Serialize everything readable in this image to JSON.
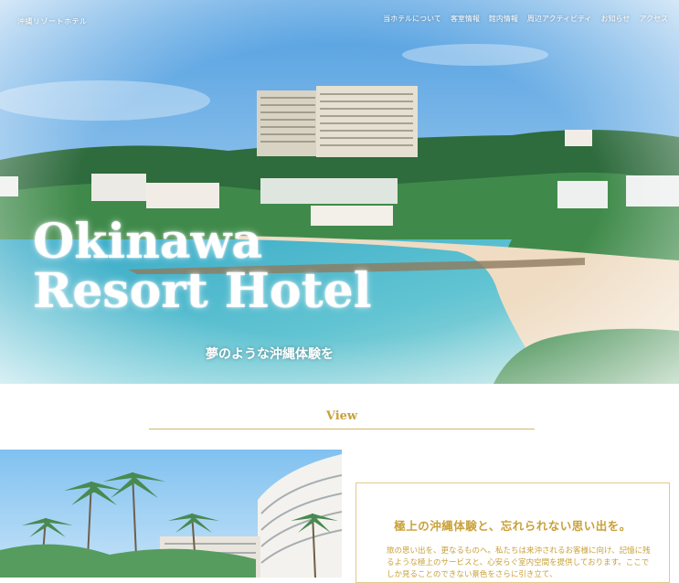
{
  "site": {
    "logo": "沖縄リゾートホテル"
  },
  "nav": {
    "items": [
      {
        "label": "当ホテルについて"
      },
      {
        "label": "客室情報"
      },
      {
        "label": "館内情報"
      },
      {
        "label": "周辺アクティビティ"
      },
      {
        "label": "お知らせ"
      },
      {
        "label": "アクセス"
      }
    ]
  },
  "hero": {
    "title_line1": "Okinawa",
    "title_line2": "Resort Hotel",
    "subtitle": "夢のような沖縄体験を"
  },
  "view": {
    "heading": "View",
    "card_title": "極上の沖縄体験と、忘れられない思い出を。",
    "card_body": "旅の思い出を、更なるものへ。私たちは来沖されるお客様に向け、記憶に残るような極上のサービスと、心安らぐ室内空間を提供しております。ここでしか見ることのできない景色をさらに引き立て、"
  },
  "colors": {
    "accent": "#c9a13a",
    "rule": "#d7b46a",
    "sky": "#7fb8e6",
    "sea": "#4fb7c9"
  }
}
